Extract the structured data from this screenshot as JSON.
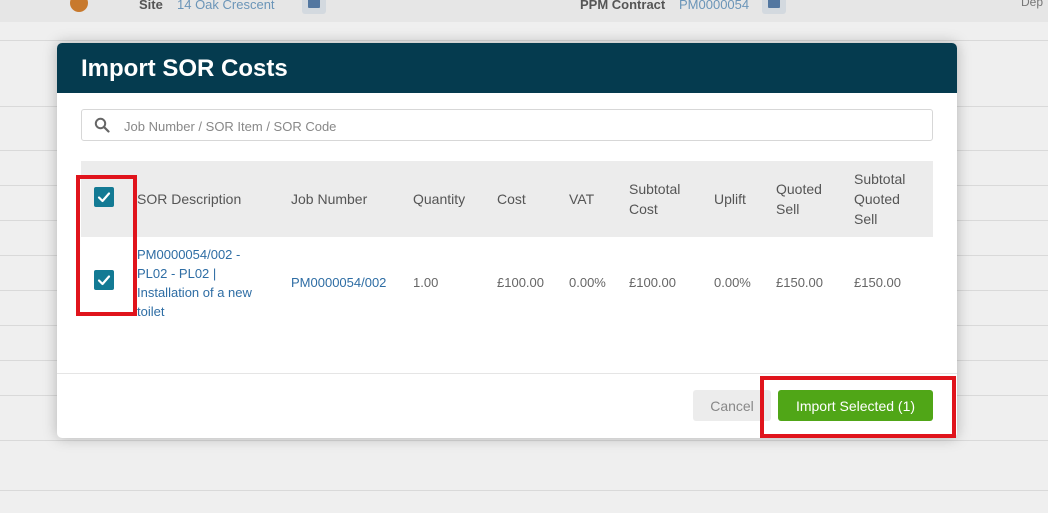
{
  "background": {
    "site_label": "Site",
    "site_value": "14 Oak Crescent",
    "contract_label": "PPM Contract",
    "contract_value": "PM0000054",
    "dep_label": "Dep"
  },
  "modal": {
    "title": "Import SOR Costs",
    "search": {
      "placeholder": "Job Number / SOR Item / SOR Code"
    },
    "columns": {
      "sor_description": "SOR Description",
      "job_number": "Job Number",
      "quantity": "Quantity",
      "cost": "Cost",
      "vat": "VAT",
      "subtotal_cost": [
        "Subtotal",
        "Cost"
      ],
      "uplift": "Uplift",
      "quoted_sell": [
        "Quoted",
        "Sell"
      ],
      "subtotal_quoted_sell": [
        "Subtotal",
        "Quoted",
        "Sell"
      ]
    },
    "rows": [
      {
        "checked": true,
        "sor_description_lines": [
          "PM0000054/002 -",
          "PL02 - PL02 |",
          "Installation of a new",
          "toilet"
        ],
        "job_number": "PM0000054/002",
        "quantity": "1.00",
        "cost": "£100.00",
        "vat": "0.00%",
        "subtotal_cost": "£100.00",
        "uplift": "0.00%",
        "quoted_sell": "£150.00",
        "subtotal_quoted_sell": "£150.00"
      }
    ],
    "footer": {
      "cancel_label": "Cancel",
      "import_label": "Import Selected (1)"
    }
  },
  "colors": {
    "header_bg": "#053b4f",
    "checkbox": "#137a94",
    "import_button": "#50a617",
    "highlight": "#e0141c",
    "link": "#2e6da4"
  }
}
